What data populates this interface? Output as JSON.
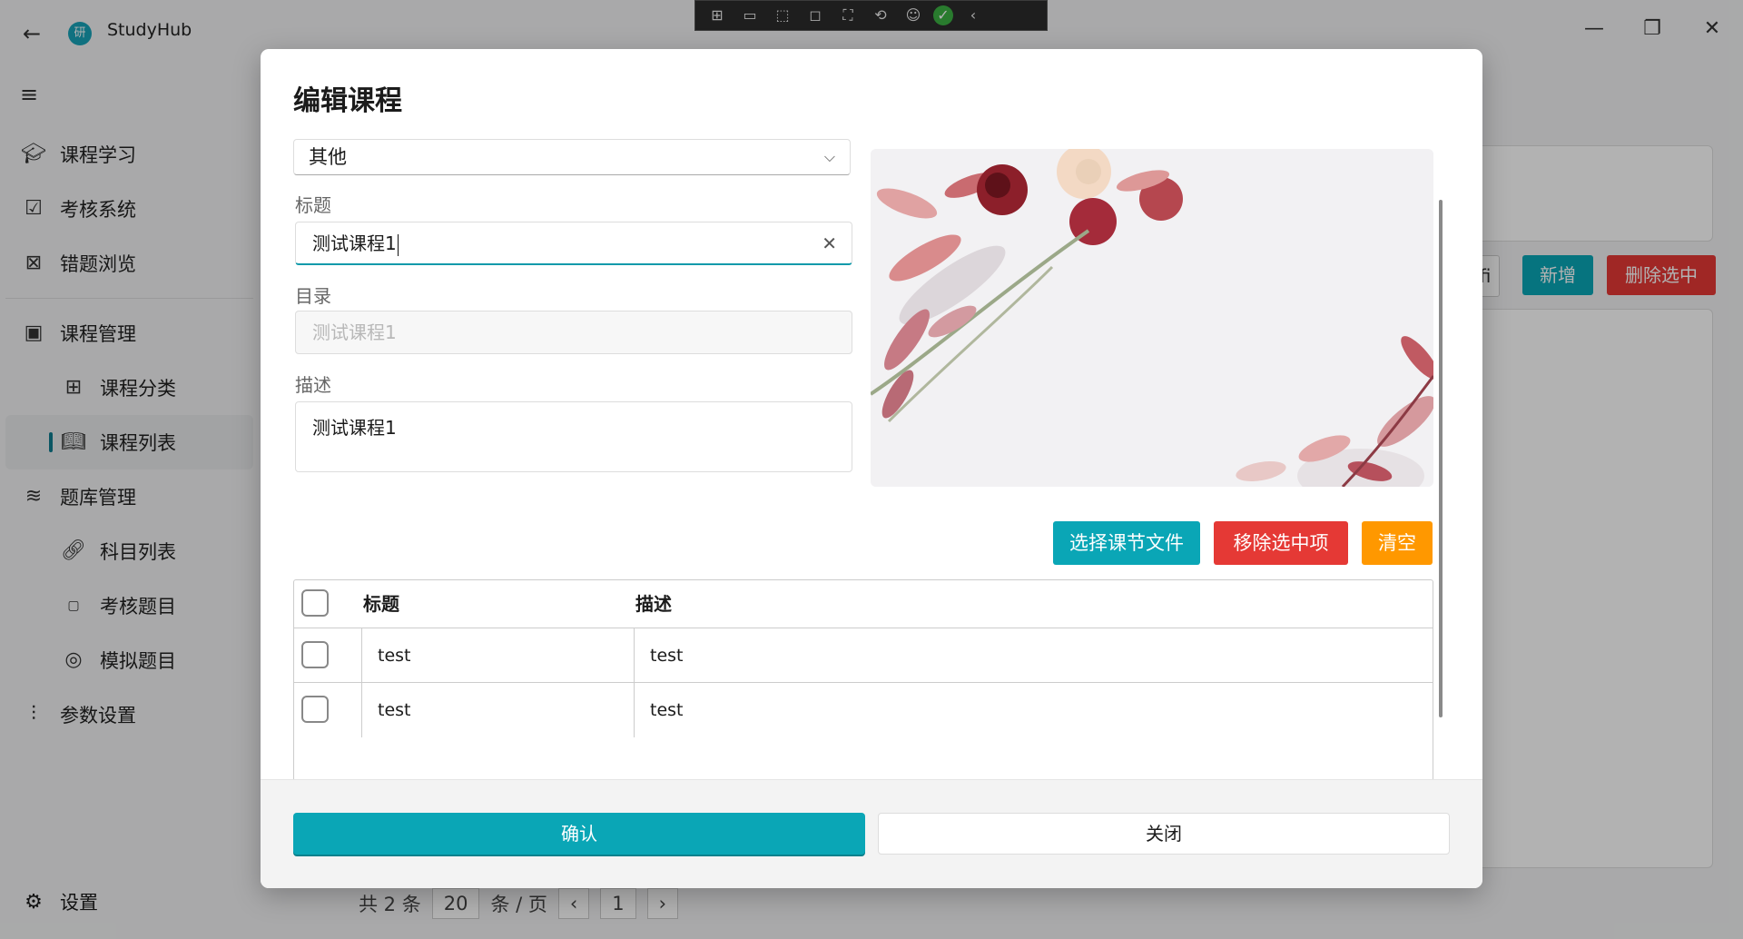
{
  "app": {
    "title": "StudyHub",
    "logo_text": "研"
  },
  "sidebar": {
    "items": [
      {
        "label": "课程学习",
        "icon": "graduation-cap-icon"
      },
      {
        "label": "考核系统",
        "icon": "checkbox-icon"
      },
      {
        "label": "错题浏览",
        "icon": "error-book-icon"
      },
      {
        "label": "课程管理",
        "icon": "course-manage-icon"
      },
      {
        "label": "课程分类",
        "icon": "grid-icon"
      },
      {
        "label": "课程列表",
        "icon": "book-icon"
      },
      {
        "label": "题库管理",
        "icon": "layers-icon"
      },
      {
        "label": "科目列表",
        "icon": "link-icon"
      },
      {
        "label": "考核题目",
        "icon": "score-100-icon"
      },
      {
        "label": "模拟题目",
        "icon": "test-icon"
      },
      {
        "label": "参数设置",
        "icon": "sliders-icon"
      }
    ],
    "settings_label": "设置"
  },
  "background": {
    "partial_button": "fi",
    "add_label": "新增",
    "delete_selected_label": "删除选中",
    "pager": {
      "total": "共 2 条",
      "page_size": "20",
      "per_page": "条 / 页",
      "current_page": "1"
    }
  },
  "dialog": {
    "title": "编辑课程",
    "category_value": "其他",
    "title_label": "标题",
    "title_value": "测试课程1",
    "directory_label": "目录",
    "directory_placeholder": "测试课程1",
    "description_label": "描述",
    "description_value": "测试课程1",
    "buttons": {
      "choose_files": "选择课节文件",
      "remove_selected": "移除选中项",
      "clear": "清空"
    },
    "table": {
      "headers": [
        "标题",
        "描述"
      ],
      "rows": [
        {
          "title": "test",
          "description": "test"
        },
        {
          "title": "test",
          "description": "test"
        }
      ]
    },
    "confirm_label": "确认",
    "close_label": "关闭"
  },
  "colors": {
    "accent": "#0aa6b6",
    "danger": "#e53935",
    "warning": "#ff9800"
  }
}
